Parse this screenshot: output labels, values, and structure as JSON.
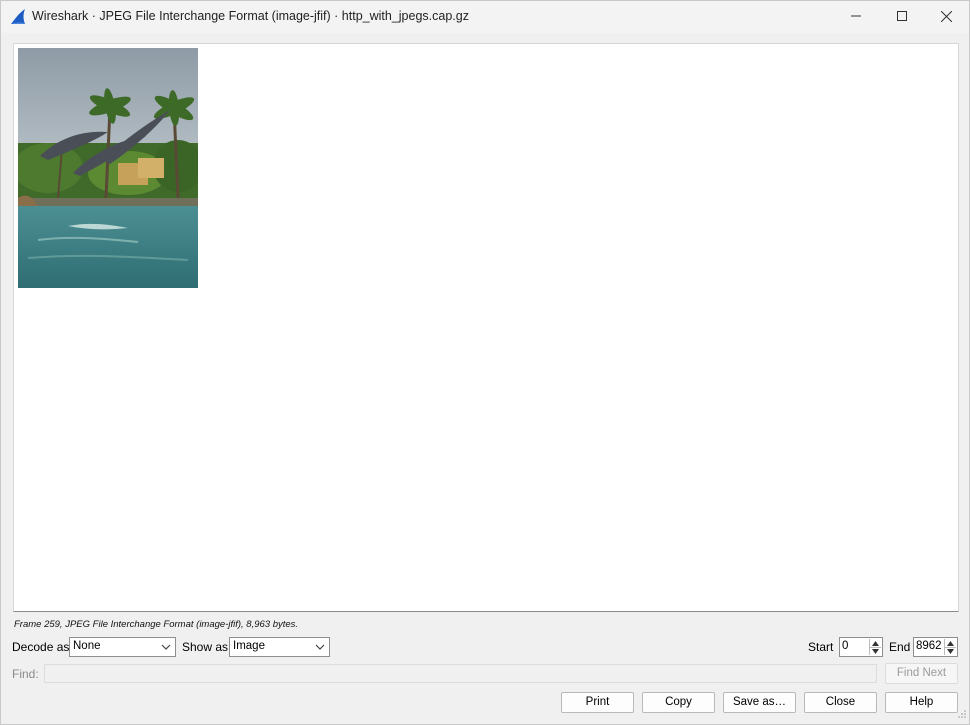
{
  "window": {
    "title": "Wireshark · JPEG File Interchange Format (image-jfif) · http_with_jpegs.cap.gz",
    "icons": [
      "wireshark-fin-icon",
      "minimize-icon",
      "maximize-icon",
      "close-icon"
    ]
  },
  "status": {
    "frame_info": "Frame 259, JPEG File Interchange Format (image-jfif), 8,963 bytes."
  },
  "controls": {
    "decode_as_label": "Decode as",
    "decode_as_value": "None",
    "show_as_label": "Show as",
    "show_as_value": "Image",
    "start_label": "Start",
    "start_value": "0",
    "end_label": "End",
    "end_value": "8962"
  },
  "find": {
    "label": "Find:",
    "value": "",
    "find_next_label": "Find Next"
  },
  "buttons": {
    "print": "Print",
    "copy": "Copy",
    "save_as": "Save as…",
    "close": "Close",
    "help": "Help"
  },
  "colors": {
    "accent_blue": "#1d5cc2",
    "window_bg": "#f0f0f0",
    "viewer_bg": "#ffffff"
  }
}
